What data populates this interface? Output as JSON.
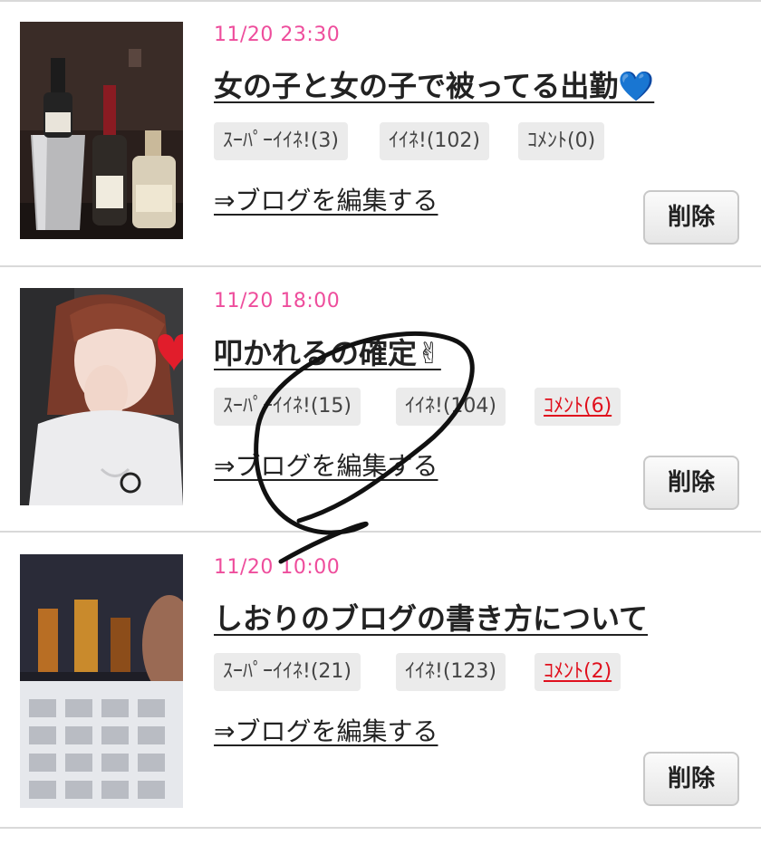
{
  "entries": [
    {
      "date": "11/20 23:30",
      "title": "女の子と女の子で被ってる出勤💙",
      "tags": {
        "super_like": "ｽｰﾊﾟｰｲｲﾈ!(3)",
        "like": "ｲｲﾈ!(102)",
        "comment": "ｺﾒﾝﾄ(0)"
      },
      "comment_active": false,
      "edit_link": "⇒ブログを編集する",
      "delete_label": "削除",
      "thumb_icon": "wine-bottles-photo"
    },
    {
      "date": "11/20 18:00",
      "title": "叩かれるの確定✌",
      "tags": {
        "super_like": "ｽｰﾊﾟｰｲｲﾈ!(15)",
        "like": "ｲｲﾈ!(104)",
        "comment": "ｺﾒﾝﾄ(6)"
      },
      "comment_active": true,
      "edit_link": "⇒ブログを編集する",
      "delete_label": "削除",
      "thumb_icon": "girl-portrait-photo"
    },
    {
      "date": "11/20 10:00",
      "title": "しおりのブログの書き方について",
      "tags": {
        "super_like": "ｽｰﾊﾟｰｲｲﾈ!(21)",
        "like": "ｲｲﾈ!(123)",
        "comment": "ｺﾒﾝﾄ(2)"
      },
      "comment_active": true,
      "edit_link": "⇒ブログを編集する",
      "delete_label": "削除",
      "thumb_icon": "phone-keyboard-photo"
    }
  ],
  "colors": {
    "date": "#ee4d9c",
    "comment_active": "#e0101d",
    "tag_bg": "#ebebeb"
  }
}
